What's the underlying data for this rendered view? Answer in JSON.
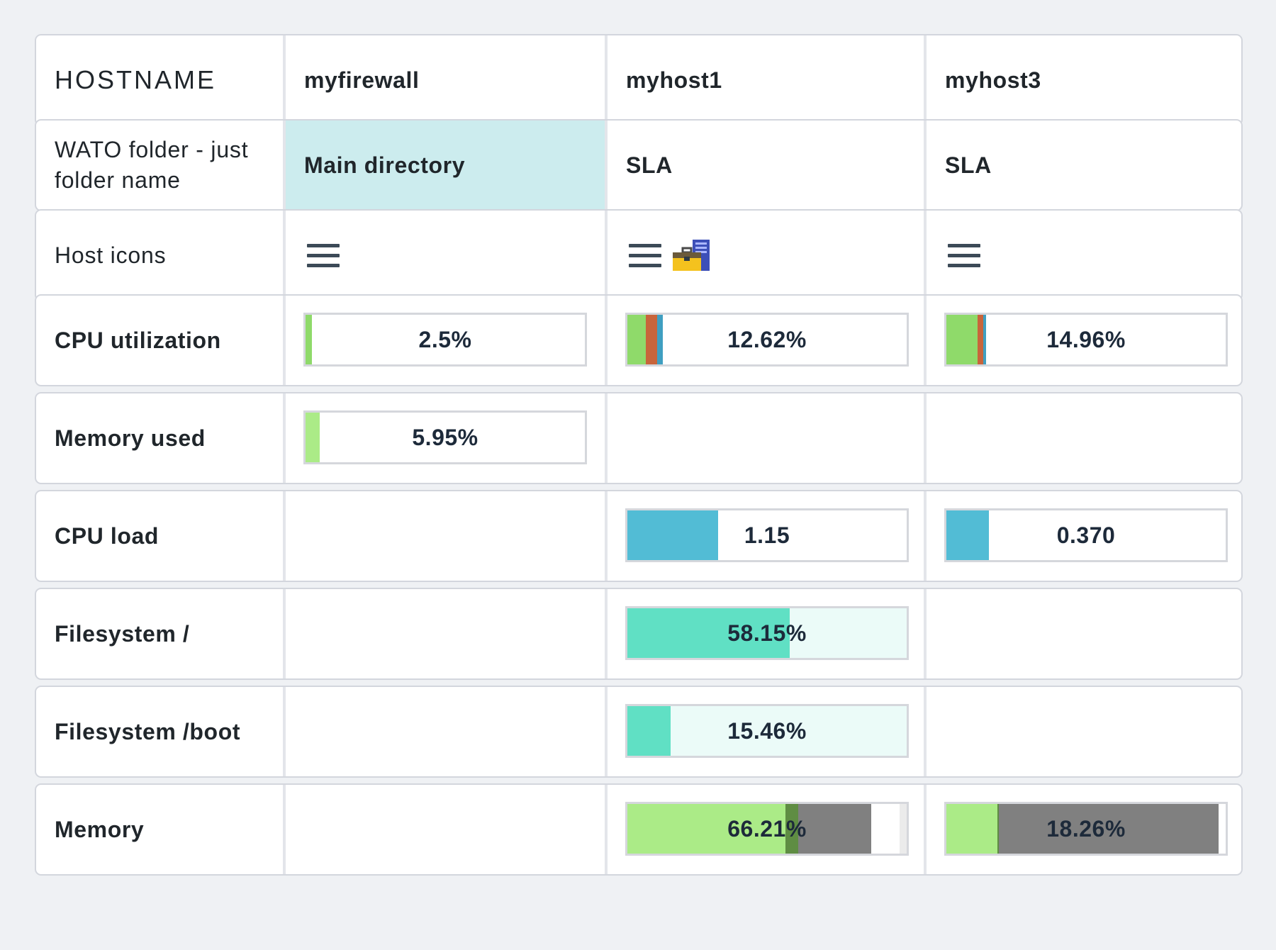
{
  "table": {
    "rows": {
      "hostname": {
        "label": "HOSTNAME",
        "values": [
          "myfirewall",
          "myhost1",
          "myhost3"
        ]
      },
      "folder": {
        "label_line1": "WATO folder - just",
        "label_line2": "folder name",
        "values": [
          "Main directory",
          "SLA",
          "SLA"
        ]
      },
      "host_icons": {
        "label": "Host icons",
        "icons": [
          [
            "menu-icon"
          ],
          [
            "menu-icon",
            "toolbox-server-icon"
          ],
          [
            "menu-icon"
          ]
        ]
      },
      "cpu_utilization": {
        "label": "CPU utilization",
        "values": [
          "2.5%",
          "12.62%",
          "14.96%"
        ]
      },
      "memory_used": {
        "label": "Memory used",
        "values": [
          "5.95%",
          "",
          ""
        ]
      },
      "cpu_load": {
        "label": "CPU load",
        "values": [
          "",
          "1.15",
          "0.370"
        ]
      },
      "filesystem_root": {
        "label": "Filesystem /",
        "values": [
          "",
          "58.15%",
          ""
        ]
      },
      "filesystem_boot": {
        "label": "Filesystem /boot",
        "values": [
          "",
          "15.46%",
          ""
        ]
      },
      "memory": {
        "label": "Memory",
        "values": [
          "",
          "66.21%",
          "18.26%"
        ]
      }
    }
  },
  "colors": {
    "page_bg": "#eff1f4",
    "main_directory_bg": "#ccecee",
    "cpu_user": "#8fda6a",
    "cpu_system": "#c8653b",
    "cpu_wait": "#3f9fc1",
    "memory_used": "#abeb87",
    "cpu_load": "#52bcd5",
    "filesystem": "#60e0c4",
    "filesystem_free": "#ebfbf8",
    "memory_ram": "#abeb87",
    "memory_swap": "#5f8d43",
    "memory_cache": "#808080"
  }
}
